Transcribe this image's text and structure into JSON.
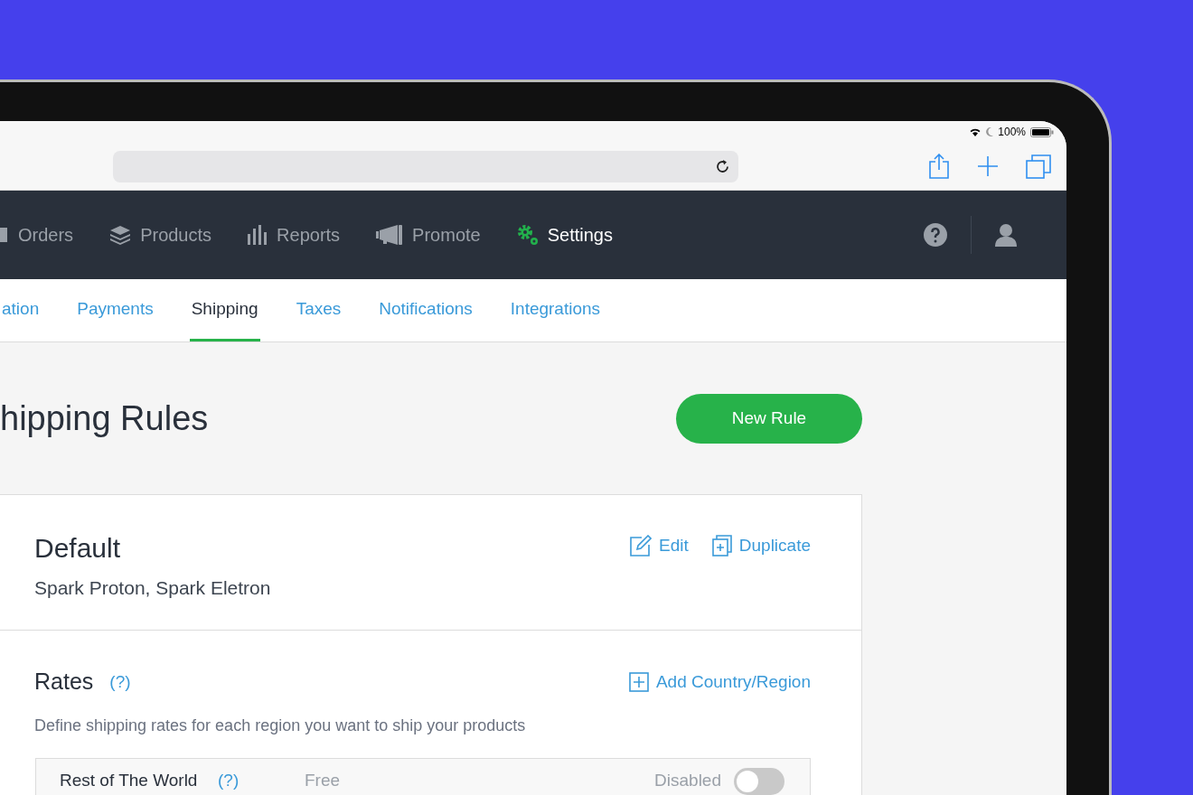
{
  "status_bar": {
    "battery": "100%"
  },
  "nav": {
    "items": [
      {
        "label": "Orders",
        "selected": false
      },
      {
        "label": "Products",
        "selected": false
      },
      {
        "label": "Reports",
        "selected": false
      },
      {
        "label": "Promote",
        "selected": false
      },
      {
        "label": "Settings",
        "selected": true
      }
    ]
  },
  "tabs": [
    {
      "label": "ation",
      "selected": false
    },
    {
      "label": "Payments",
      "selected": false
    },
    {
      "label": "Shipping",
      "selected": true
    },
    {
      "label": "Taxes",
      "selected": false
    },
    {
      "label": "Notifications",
      "selected": false
    },
    {
      "label": "Integrations",
      "selected": false
    }
  ],
  "page": {
    "title": "hipping Rules",
    "new_button": "New Rule"
  },
  "rule": {
    "name": "Default",
    "products": "Spark Proton, Spark Eletron",
    "actions": [
      "Edit",
      "Duplicate"
    ]
  },
  "rates": {
    "title": "Rates",
    "help": "(?)",
    "add": "Add Country/Region",
    "description": "Define shipping rates for each region you want to ship your products",
    "rows": [
      {
        "name": "Rest of The World",
        "help": "(?)",
        "price": "Free",
        "status": "Disabled",
        "on": false
      }
    ]
  }
}
